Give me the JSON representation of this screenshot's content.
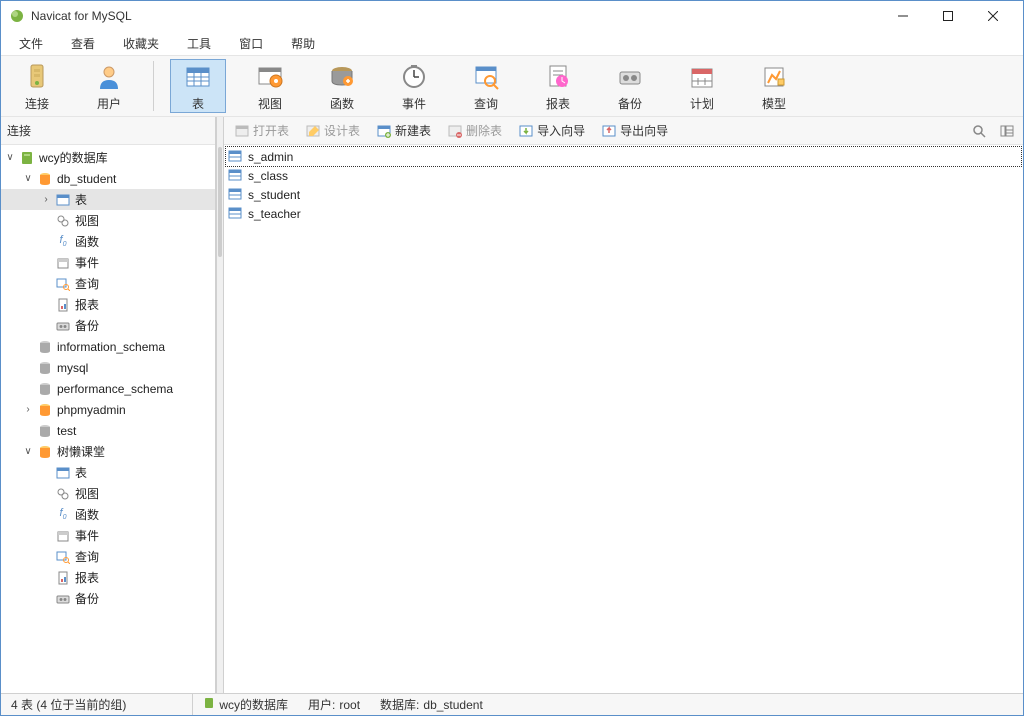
{
  "window": {
    "title": "Navicat for MySQL"
  },
  "menu": {
    "file": "文件",
    "view": "查看",
    "fav": "收藏夹",
    "tool": "工具",
    "win": "窗口",
    "help": "帮助"
  },
  "toolbar": {
    "conn": "连接",
    "user": "用户",
    "table": "表",
    "view": "视图",
    "func": "函数",
    "event": "事件",
    "query": "查询",
    "report": "报表",
    "backup": "备份",
    "plan": "计划",
    "model": "模型"
  },
  "sidebar": {
    "header": "连接",
    "root": "wcy的数据库",
    "db_student": "db_student",
    "folders": {
      "table": "表",
      "view": "视图",
      "func": "函数",
      "event": "事件",
      "query": "查询",
      "report": "报表",
      "backup": "备份"
    },
    "dbs": {
      "info_schema": "information_schema",
      "mysql": "mysql",
      "perf_schema": "performance_schema",
      "phpmyadmin": "phpmyadmin",
      "test": "test",
      "sl": "树懒课堂"
    }
  },
  "subtoolbar": {
    "open": "打开表",
    "design": "设计表",
    "new": "新建表",
    "delete": "删除表",
    "import": "导入向导",
    "export": "导出向导"
  },
  "tables": {
    "t0": "s_admin",
    "t1": "s_class",
    "t2": "s_student",
    "t3": "s_teacher"
  },
  "status": {
    "count": "4 表 (4 位于当前的组)",
    "conn": "wcy的数据库",
    "user_label": "用户:",
    "user": "root",
    "db_label": "数据库:",
    "db": "db_student"
  }
}
